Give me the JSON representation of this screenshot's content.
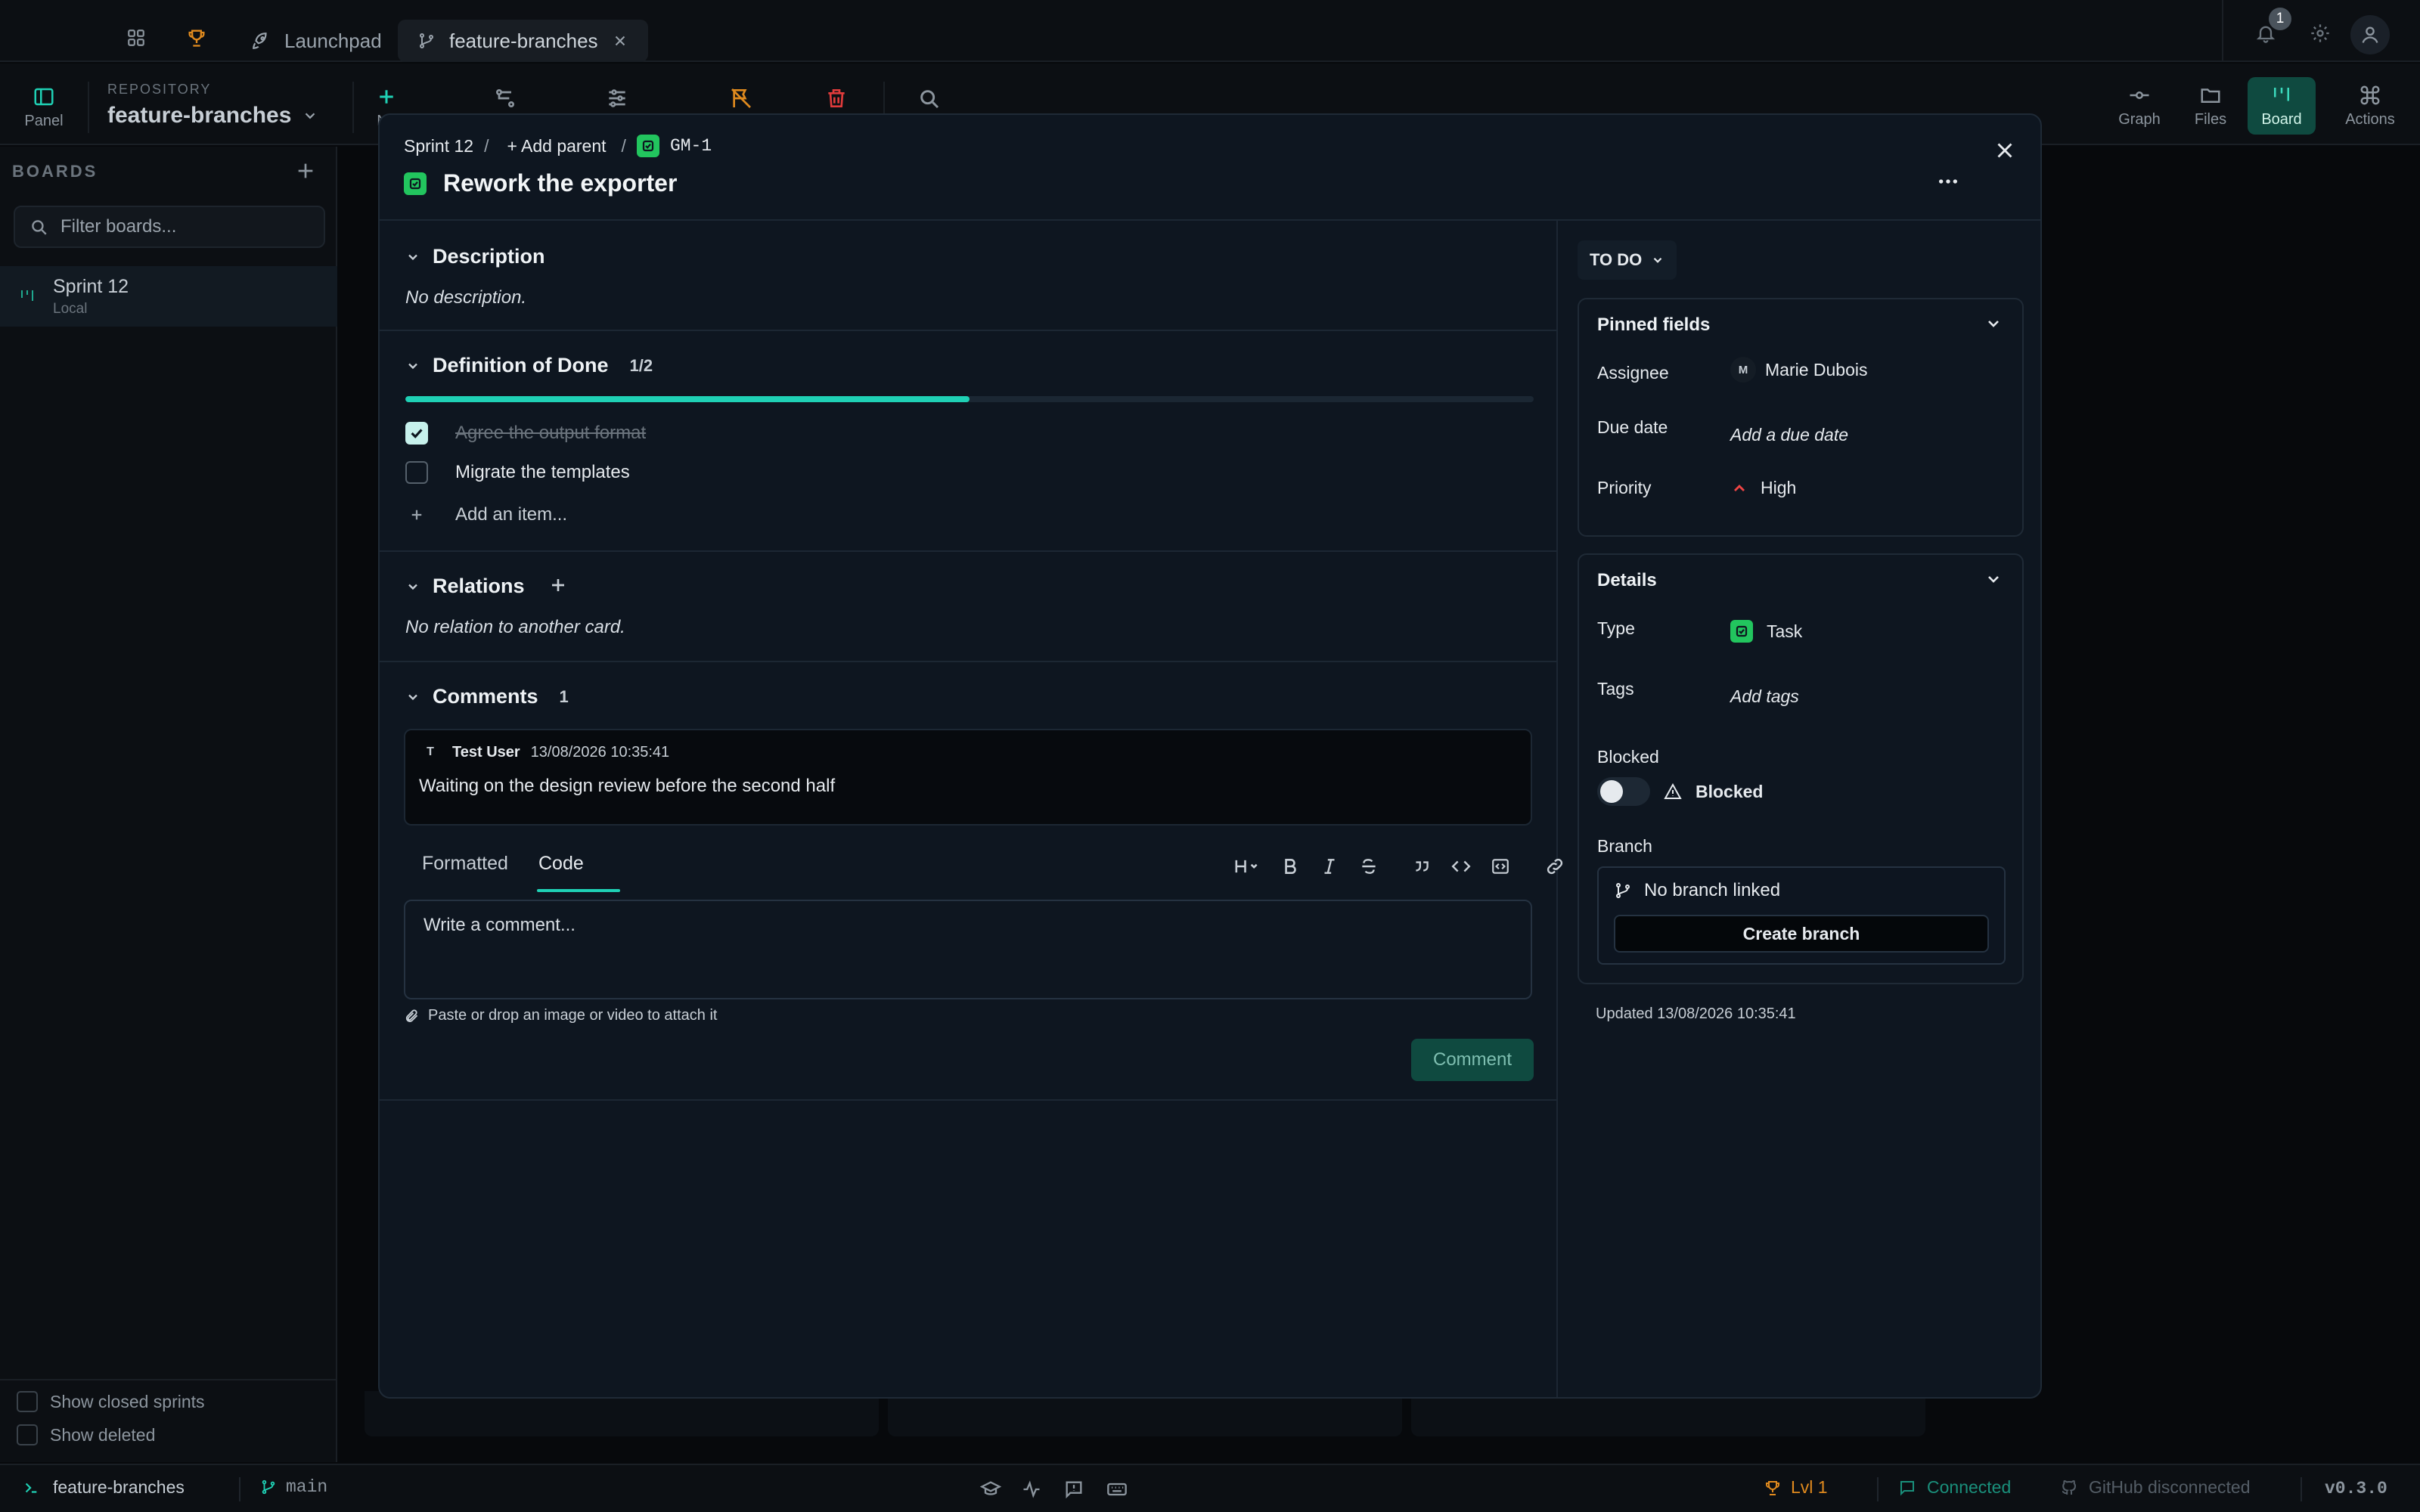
{
  "topbar": {
    "tabs": [
      {
        "label": "Launchpad"
      },
      {
        "label": "feature-branches"
      }
    ],
    "notification_count": "1"
  },
  "toolbar": {
    "panel_label": "Panel",
    "repo_caption": "REPOSITORY",
    "repo_name": "feature-branches",
    "new_label": "Ne",
    "graph_label": "Graph",
    "files_label": "Files",
    "board_label": "Board",
    "actions_label": "Actions"
  },
  "sidebar": {
    "boards_caption": "BOARDS",
    "filter_placeholder": "Filter boards...",
    "items": [
      {
        "title": "Sprint 12",
        "subtitle": "Local"
      }
    ],
    "show_closed": "Show closed sprints",
    "show_deleted": "Show deleted"
  },
  "statusbar": {
    "repo": "feature-branches",
    "branch": "main",
    "level": "Lvl 1",
    "connection": "Connected",
    "github": "GitHub disconnected",
    "version": "v0.3.0"
  },
  "card": {
    "breadcrumb": {
      "sprint": "Sprint 12",
      "sep": "/",
      "add_parent": "+ Add parent",
      "key": "GM-1"
    },
    "title": "Rework the exporter",
    "description": {
      "heading": "Description",
      "text": "No description."
    },
    "dod": {
      "heading": "Definition of Done",
      "count": "1/2",
      "progress": 0.5,
      "items": [
        {
          "label": "Agree the output format",
          "done": true
        },
        {
          "label": "Migrate the templates",
          "done": false
        }
      ],
      "add_item": "Add an item..."
    },
    "relations": {
      "heading": "Relations",
      "text": "No relation to another card."
    },
    "comments": {
      "heading": "Comments",
      "count": "1",
      "items": [
        {
          "avatar": "T",
          "author": "Test User",
          "timestamp": "13/08/2026 10:35:41",
          "text": "Waiting on the design review before the second half"
        }
      ],
      "editor_tabs": [
        "Formatted",
        "Code"
      ],
      "active_tab": "Code",
      "placeholder": "Write a comment...",
      "attach_hint": "Paste or drop an image or video to attach it",
      "submit": "Comment"
    },
    "status": "TO DO",
    "pinned": {
      "heading": "Pinned fields",
      "assignee_label": "Assignee",
      "assignee_avatar": "M",
      "assignee": "Marie Dubois",
      "due_label": "Due date",
      "due_placeholder": "Add a due date",
      "priority_label": "Priority",
      "priority": "High"
    },
    "details": {
      "heading": "Details",
      "type_label": "Type",
      "type": "Task",
      "tags_label": "Tags",
      "tags_placeholder": "Add tags",
      "blocked_label": "Blocked",
      "blocked_toggle_label": "Blocked",
      "branch_label": "Branch",
      "no_branch": "No branch linked",
      "create_branch": "Create branch"
    },
    "updated": "Updated 13/08/2026 10:35:41"
  },
  "colors": {
    "accent": "#1fd1b5",
    "task_green": "#22c55e",
    "priority_red": "#ef4444",
    "level_orange": "#e08a1e"
  }
}
